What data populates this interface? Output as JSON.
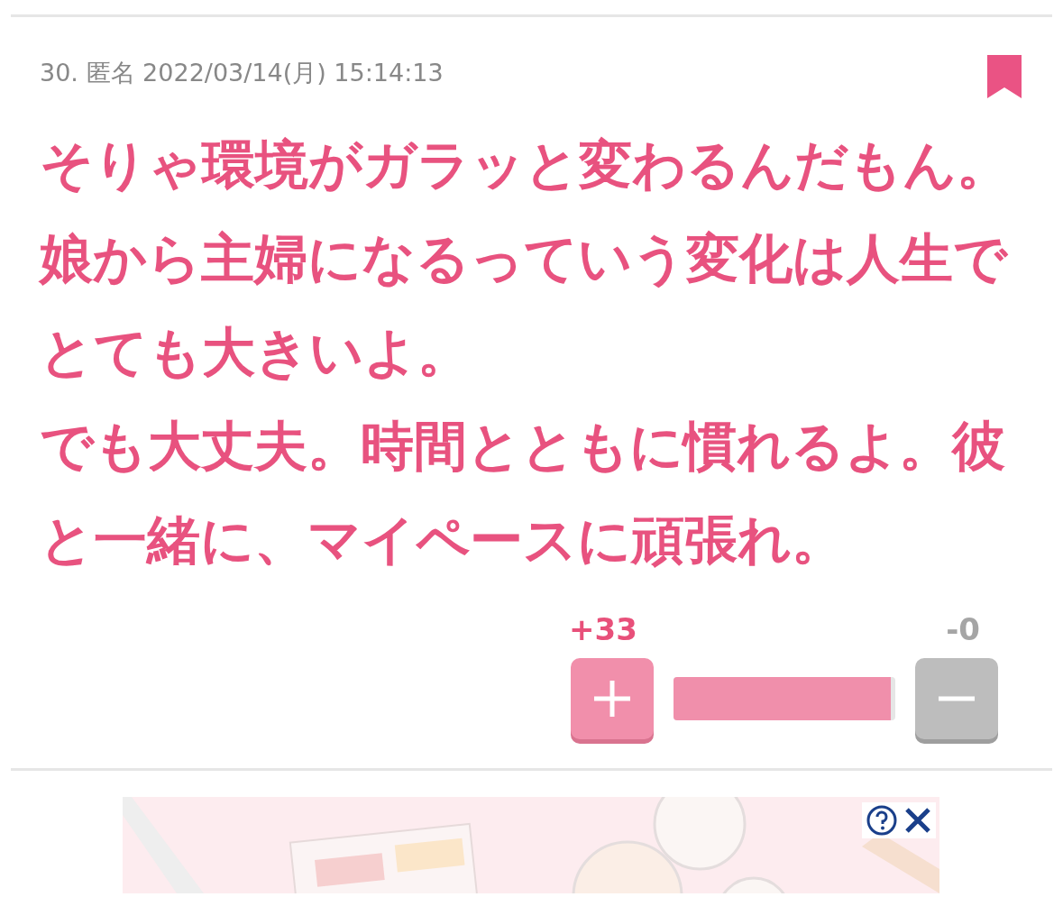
{
  "comment": {
    "number": "30.",
    "author": "匿名",
    "date": "2022/03/14(月) 15:14:13",
    "bookmarked": true,
    "paragraphs": [
      "そりゃ環境がガラッと変わるんだもん。",
      "娘から主婦になるっていう変化は人生でとても大きいよ。",
      "でも大丈夫。時間とともに慣れるよ。彼と一緒に、マイペースに頑張れ。"
    ],
    "votes": {
      "plus": "+33",
      "minus": "-0",
      "level": 1
    }
  }
}
